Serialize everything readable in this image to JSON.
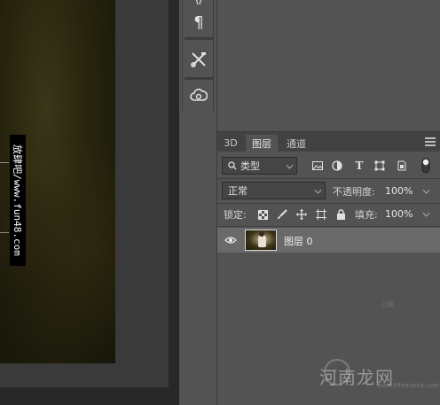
{
  "canvas": {
    "watermark_text": "放肆吧/www.fun48.com"
  },
  "tools": [
    {
      "name": "paragraph-icon",
      "glyph": "¶"
    },
    {
      "name": "tool-presets-icon",
      "glyph": "✂"
    },
    {
      "name": "creative-cloud-icon",
      "glyph": "☁"
    }
  ],
  "layers_panel": {
    "tabs": [
      "3D",
      "图层",
      "通道"
    ],
    "active_tab": "图层",
    "filter": {
      "label": "类型"
    },
    "blend_mode": "正常",
    "opacity_label": "不透明度:",
    "opacity_value": "100%",
    "lock_label": "锁定:",
    "fill_label": "填充:",
    "fill_value": "100%",
    "layers": [
      {
        "name": "图层 0",
        "visible": true,
        "selected": true
      }
    ]
  },
  "overlay": {
    "site_logo": "河南龙网",
    "site_url": "www.Fifamania.com",
    "bg_mark": "儿网"
  }
}
